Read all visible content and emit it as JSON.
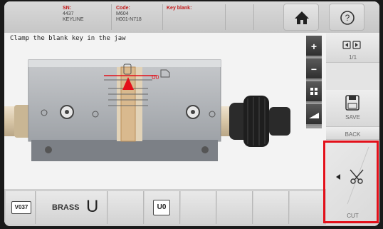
{
  "header": {
    "sn_label": "SN:",
    "sn_value": "4437",
    "sn_sub": "KEYLINE",
    "code_label": "Code:",
    "code_value": "M604",
    "code_sub": "H001-N718",
    "blank_label": "Key blank:"
  },
  "instruction": "Clamp the blank key in the jaw",
  "jaw": {
    "u_marker": "U0"
  },
  "side": {
    "page": "1/1",
    "save_label": "SAVE",
    "back_label": "BACK",
    "cut_label": "CUT"
  },
  "bottom": {
    "key_code": "V037",
    "material": "BRASS",
    "profile": "U",
    "tag": "U0"
  },
  "icons": {
    "home": "home-icon",
    "help": "help-icon",
    "zoom_in": "plus-icon",
    "zoom_out": "minus-icon",
    "fit": "fit-icon",
    "ruler": "ruler-icon",
    "navigate": "arrows-icon",
    "save": "floppy-disk-icon",
    "cut": "key-cut-icon",
    "arrow": "left-arrow-icon"
  },
  "colors": {
    "accent": "#c21818",
    "highlight": "#e3101a"
  }
}
